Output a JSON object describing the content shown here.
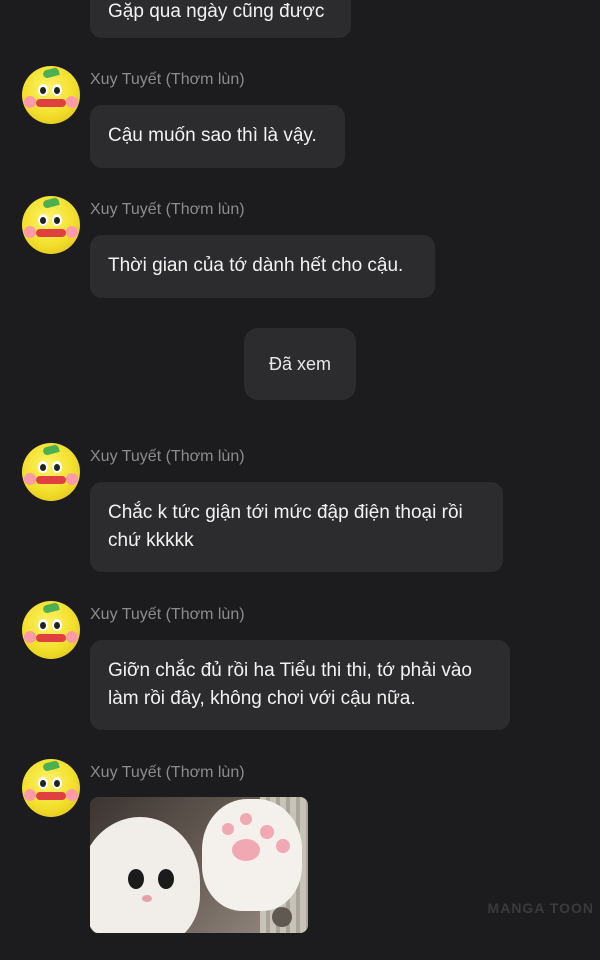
{
  "messages": [
    {
      "text": "Gặp qua ngày cũng được"
    },
    {
      "sender": "Xuy Tuyết (Thơm lùn)",
      "lines": [
        "Cậu muốn sao thì là vậy."
      ]
    },
    {
      "sender": "Xuy Tuyết (Thơm lùn)",
      "lines": [
        "Thời gian của tớ dành hết cho cậu."
      ]
    },
    {
      "sender": "Xuy Tuyết (Thơm lùn)",
      "lines": [
        "Chắc k tức giận tới mức đập điện thoại rồi",
        "chứ kkkkk"
      ]
    },
    {
      "sender": "Xuy Tuyết (Thơm lùn)",
      "lines": [
        "Giỡn chắc đủ rồi ha Tiểu thi thi, tớ phải vào",
        "làm rồi đây, không chơi với cậu nữa."
      ]
    },
    {
      "sender": "Xuy Tuyết (Thơm lùn)",
      "image": "cat-photo"
    }
  ],
  "seen_label": "Đã xem",
  "watermark": "MANGA TOON",
  "colors": {
    "background": "#1c1c1e",
    "bubble": "#2c2c2e",
    "text": "#f2f2f2",
    "sender": "#8c8c8e"
  }
}
